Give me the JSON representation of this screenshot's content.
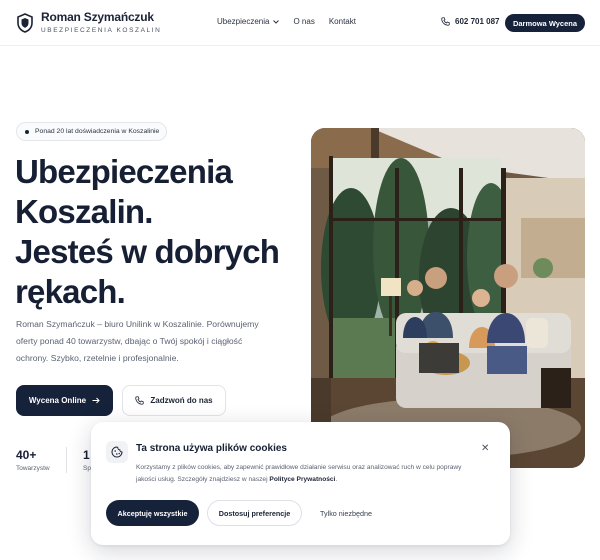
{
  "brand": {
    "name": "Roman Szymańczuk",
    "subtitle": "UBEZPIECZENIA KOSZALIN",
    "logo_icon": "shield-icon"
  },
  "nav": {
    "items": [
      {
        "label": "Ubezpieczenia",
        "has_dropdown": true
      },
      {
        "label": "O nas"
      },
      {
        "label": "Kontakt"
      }
    ]
  },
  "header": {
    "phone": "602 701 087",
    "phone_icon": "phone-icon",
    "cta_label": "Darmowa Wycena"
  },
  "hero": {
    "badge": "Ponad 20 lat doświadczenia w Koszalinie",
    "title_lines": [
      "Ubezpieczenia",
      "Koszalin.",
      "Jesteś w dobrych",
      "rękach."
    ],
    "description": "Roman Szymańczuk – biuro Unilink w Koszalinie. Porównujemy oferty ponad 40 towarzystw, dbając o Twój spokój i ciągłość ochrony. Szybko, rzetelnie i profesjonalnie.",
    "primary_button": "Wycena Online",
    "secondary_button": "Zadzwoń do nas",
    "stats": [
      {
        "number": "40+",
        "label": "Towarzystw"
      },
      {
        "number": "1",
        "label": "Sp"
      }
    ]
  },
  "cookie": {
    "title": "Ta strona używa plików cookies",
    "text": "Korzystamy z plików cookies, aby zapewnić prawidłowe działanie serwisu oraz analizować ruch w celu poprawy jakości usług. Szczegóły znajdziesz w naszej",
    "policy_link": "Polityce Prywatności",
    "accept_label": "Akceptuję wszystkie",
    "prefs_label": "Dostosuj preferencje",
    "necessary_label": "Tylko niezbędne",
    "close_icon": "close-icon"
  },
  "colors": {
    "primary": "#16213a",
    "text": "#161f33",
    "muted": "#5b6272"
  }
}
